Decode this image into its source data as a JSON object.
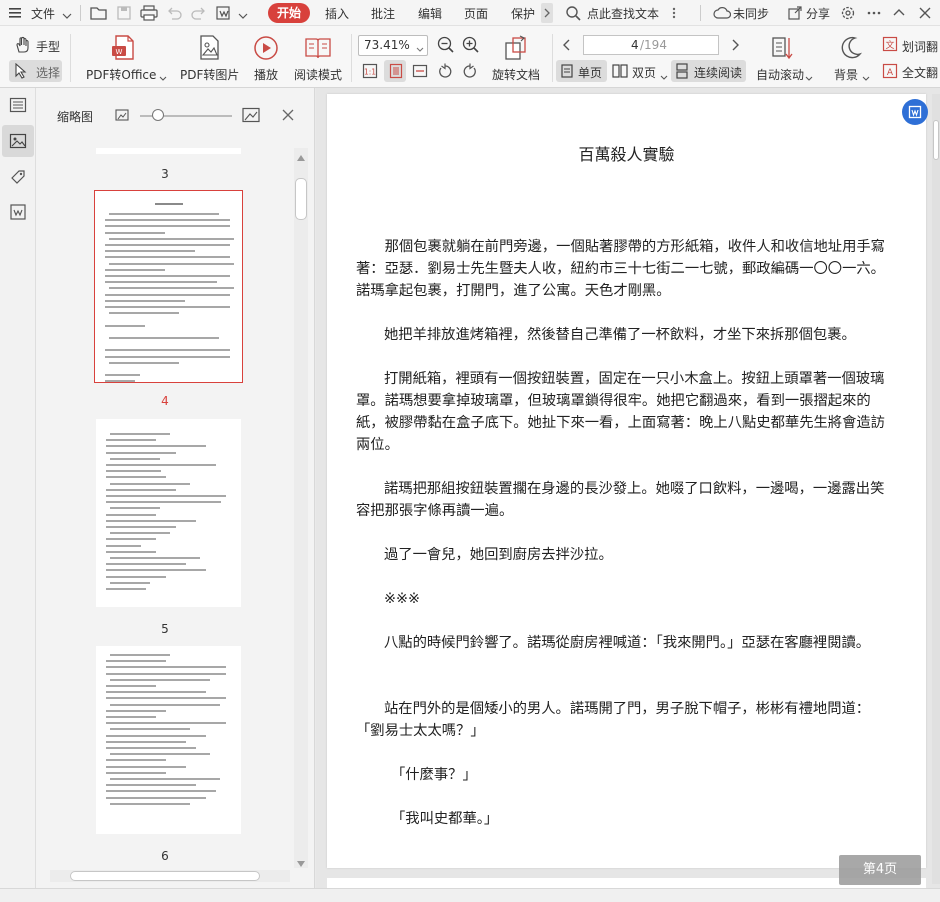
{
  "menubar": {
    "file": "文件",
    "tabs": [
      "开始",
      "插入",
      "批注",
      "编辑",
      "页面",
      "保护"
    ],
    "search": "点此查找文本",
    "sync": "未同步",
    "share": "分享"
  },
  "ribbon": {
    "hand": "手型",
    "select": "选择",
    "pdf_to_office": "PDF转Office",
    "pdf_to_image": "PDF转图片",
    "play": "播放",
    "read_mode": "阅读模式",
    "zoom": "73.41%",
    "rotate": "旋转文档",
    "page_current": "4",
    "page_total": "/194",
    "single": "单页",
    "double": "双页",
    "continuous": "连续阅读",
    "auto_scroll": "自动滚动",
    "background": "背景",
    "dict": "划词翻",
    "fulltext": "全文翻"
  },
  "thumbpanel": {
    "title": "缩略图",
    "pages": [
      "3",
      "4",
      "5",
      "6"
    ],
    "current_page": "4",
    "zoom_slider_level": 0.2
  },
  "document": {
    "title": "百萬殺人實驗",
    "paragraphs": [
      "　　那個包裹就躺在前門旁邊，一個貼著膠帶的方形紙箱，收件人和收信地址用手寫著：亞瑟．劉易士先生暨夫人收，紐約市三十七街二一七號，郵政編碼一〇〇一六。諾瑪拿起包裹，打開門，進了公寓。天色才剛黑。",
      "她把羊排放進烤箱裡，然後替自己準備了一杯飲料，才坐下來拆那個包裹。",
      "打開紙箱，裡頭有一個按鈕裝置，固定在一只小木盒上。按鈕上頭罩著一個玻璃罩。諾瑪想要拿掉玻璃罩，但玻璃罩鎖得很牢。她把它翻過來，看到一張摺起來的紙，被膠帶黏在盒子底下。她扯下來一看，上面寫著：晚上八點史都華先生將會造訪兩位。",
      "諾瑪把那組按鈕裝置擱在身邊的長沙發上。她啜了口飲料，一邊喝，一邊露出笑容把那張字條再讀一遍。",
      "過了一會兒，她回到廚房去拌沙拉。",
      "※※※",
      "八點的時候門鈴響了。諾瑪從廚房裡喊道：「我來開門。」亞瑟在客廳裡閱讀。",
      "站在門外的是個矮小的男人。諾瑪開了門，男子脫下帽子，彬彬有禮地問道：「劉易士太太嗎？」",
      "「什麼事？」",
      "「我叫史都華。」"
    ],
    "page_badge": "第4页"
  },
  "colors": {
    "accent": "#d8413c",
    "badge_bg": "#9a9a9a",
    "float_btn": "#2e6fd6"
  }
}
